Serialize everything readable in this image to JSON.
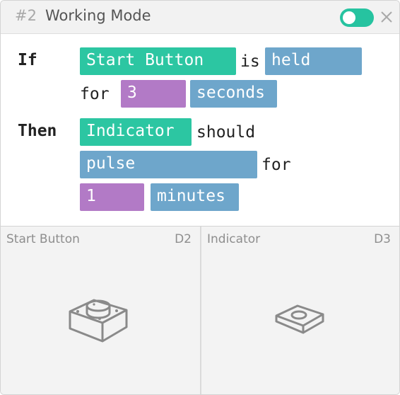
{
  "header": {
    "rule_number": "#2",
    "title": "Working Mode",
    "enabled": true,
    "accent_color": "#26c3a0",
    "toggle_icon": "toggle-switch-icon",
    "close_icon": "close-icon"
  },
  "rule": {
    "if_keyword": "If",
    "trigger_device": "Start Button",
    "is_word": "is",
    "trigger_state": "held",
    "for_word": "for",
    "duration_value": "3",
    "duration_unit": "seconds",
    "then_keyword": "Then",
    "action_device": "Indicator",
    "should_word": "should",
    "action": "pulse",
    "for_word_2": "for",
    "action_duration_value": "1",
    "action_duration_unit": "minutes"
  },
  "colors": {
    "device_chip": "#2cc6a2",
    "value_chip": "#b27ac6",
    "option_chip": "#6ea6cb"
  },
  "devices": [
    {
      "name": "Start Button",
      "pin": "D2",
      "icon": "push-button-icon"
    },
    {
      "name": "Indicator",
      "pin": "D3",
      "icon": "led-indicator-icon"
    }
  ]
}
